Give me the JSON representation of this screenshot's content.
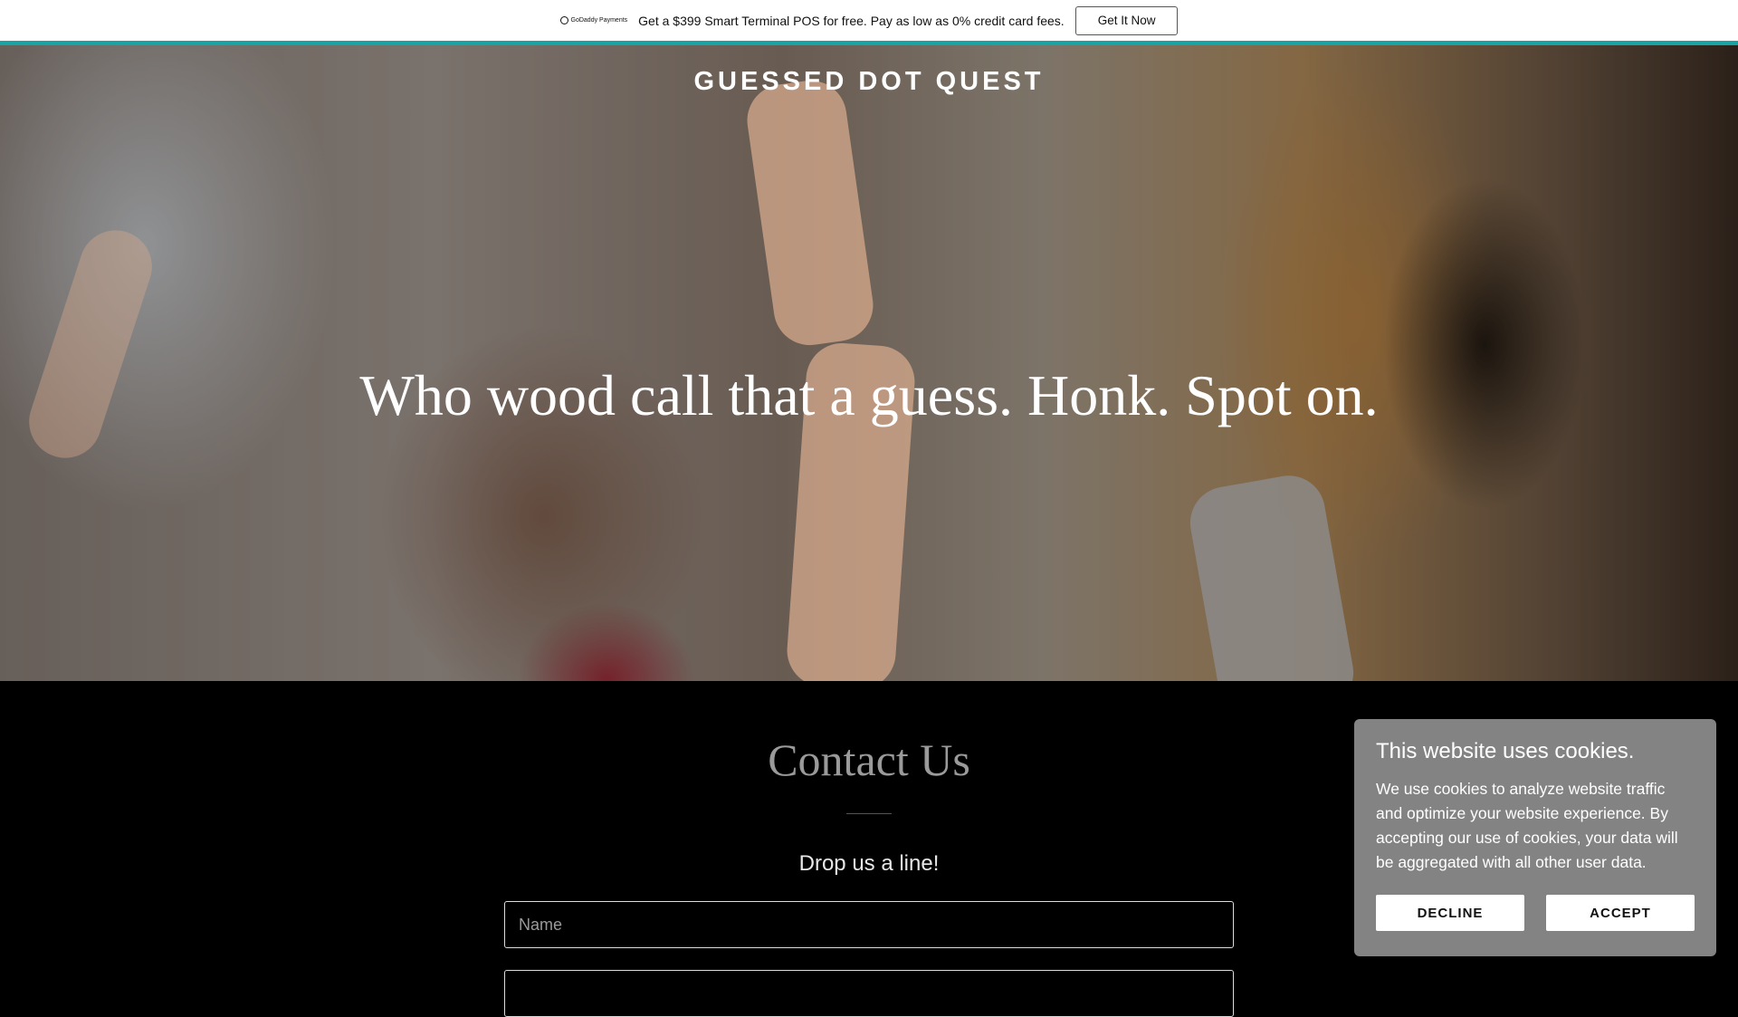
{
  "promo_bar": {
    "logo_text": "GoDaddy Payments",
    "message": "Get a $399 Smart Terminal POS for free. Pay as low as 0% credit card fees.",
    "cta_label": "Get It Now",
    "accent_color": "#1aa3a3"
  },
  "header": {
    "site_title": "GUESSED DOT QUEST"
  },
  "hero": {
    "headline": "Who wood call that a guess. Honk. Spot on."
  },
  "contact": {
    "title": "Contact Us",
    "subtitle": "Drop us a line!",
    "name_placeholder": "Name"
  },
  "cookie_banner": {
    "title": "This website uses cookies.",
    "body": "We use cookies to analyze website traffic and optimize your website experience. By accepting our use of cookies, your data will be aggregated with all other user data.",
    "decline_label": "DECLINE",
    "accept_label": "ACCEPT"
  }
}
